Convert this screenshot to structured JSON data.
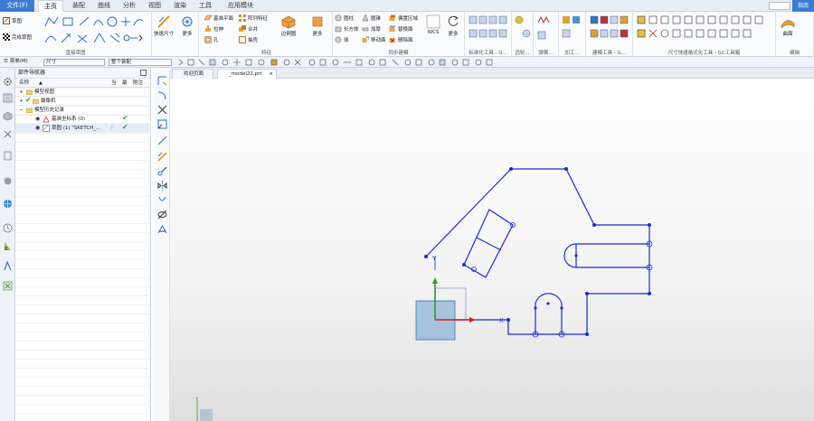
{
  "menu": {
    "file": "文件(F)",
    "tabs": [
      "主页",
      "装配",
      "曲线",
      "分析",
      "视图",
      "渲染",
      "工具",
      "应用模块"
    ],
    "active_index": 0,
    "help": "指南"
  },
  "ribbon": {
    "direct_sketch": {
      "label": "直接草图",
      "sketch": "草图",
      "finish_sketch": "完成草图",
      "more": "更多"
    },
    "rapid_dim": {
      "label": "快速尺寸",
      "more": "更多"
    },
    "feature": {
      "label": "特征",
      "datum_plane": "基准平面",
      "pattern": "阵列特征",
      "extrude": "拉伸",
      "unite": "合并",
      "hole": "孔",
      "shell": "抽壳",
      "edge_blend": "边倒圆",
      "more": "更多"
    },
    "sync": {
      "label": "同步建模",
      "cylinder": "圆柱",
      "cone": "圆锥",
      "block": "长方体",
      "thicken": "加厚",
      "sphere": "球",
      "offset_region": "偏置区域",
      "replace_face": "替换面",
      "move_face": "移动面",
      "delete_face": "删除面",
      "wcs": "WCS",
      "more": "更多"
    },
    "tool_groups": [
      "标准化工具 - G...",
      "齿轮...",
      "弹簧...",
      "加工...",
      "建模工具 - G...",
      "尺寸快速格式化工具 - GC工具箱",
      "曲面",
      "编辑"
    ]
  },
  "selbar": {
    "menu": "菜单(M)",
    "filter": "尺寸",
    "scope": "整个装配"
  },
  "navigator": {
    "title": "部件导航器",
    "columns": {
      "name": "名称",
      "current": "当",
      "latest": "最",
      "note": "附注"
    },
    "rows": [
      {
        "label": "模型视图",
        "level": 0,
        "check": false
      },
      {
        "label": "摄像机",
        "level": 0,
        "check": true
      },
      {
        "label": "模型历史记录",
        "level": 0,
        "check": false
      },
      {
        "label": "基准坐标系 (0)",
        "level": 1,
        "check": true
      },
      {
        "label": "草图 (1) \"SKETCH_...",
        "level": 1,
        "check": true
      }
    ]
  },
  "doc_tabs": [
    "欢迎页面",
    "_model22.prt"
  ],
  "canvas": {
    "axis_y": "Y",
    "axis_x": "X",
    "colors": {
      "sketch": "#1a2bd6",
      "axis_green": "#2b9a2b",
      "axis_red": "#d62020",
      "box": "#8fb4d8"
    }
  }
}
